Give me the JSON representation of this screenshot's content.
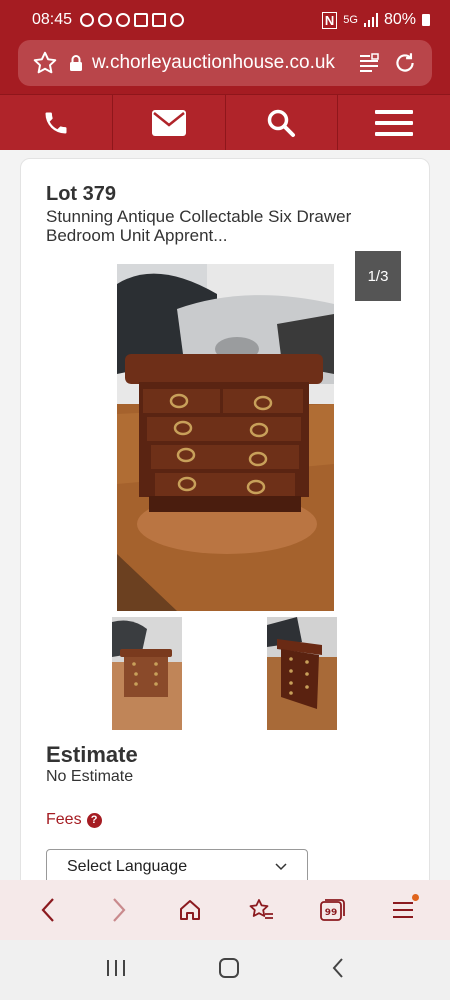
{
  "status_bar": {
    "time": "08:45",
    "network": "5G",
    "battery": "80%"
  },
  "browser": {
    "url": "w.chorleyauctionhouse.co.uk"
  },
  "site_nav": {
    "icons": [
      "phone-icon",
      "envelope-icon",
      "search-icon",
      "menu-icon"
    ]
  },
  "lot": {
    "title": "Lot 379",
    "description": "Stunning Antique Collectable Six Drawer Bedroom Unit Apprent...",
    "image_counter": "1/3"
  },
  "estimate": {
    "heading": "Estimate",
    "value": "No Estimate"
  },
  "fees": {
    "label": "Fees"
  },
  "language_select": {
    "selected": "Select Language"
  },
  "colors": {
    "brand": "#a51c22",
    "counter_bg": "#555555",
    "accent_dot": "#e0641c"
  }
}
